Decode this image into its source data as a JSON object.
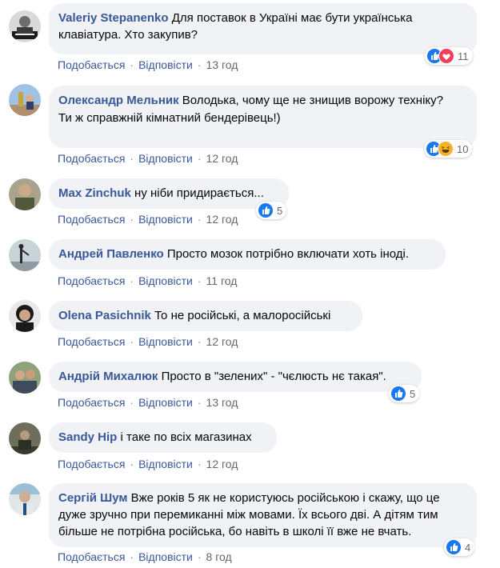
{
  "actions": {
    "like": "Подобається",
    "reply": "Відповісти",
    "sep": "·"
  },
  "colors": {
    "bubble": "#f0f2f5",
    "author": "#385898",
    "meta": "#65676b",
    "like": "#1877f2",
    "love": "#f33e58",
    "haha": "#f7b125"
  },
  "comments": [
    {
      "author": "Valeriy Stepanenko",
      "text": "Для поставок в Україні має бути українська клавіатура. Хто закупив?",
      "time": "13 год",
      "reactions": [
        "like-icon",
        "love-icon"
      ],
      "count": "11"
    },
    {
      "author": "Олександр Мельник",
      "text": "Володька, чому ще не знищив ворожу техніку?\nТи ж справжній кімнатний бендерівець!)",
      "time": "12 год",
      "reactions": [
        "like-icon",
        "haha-icon"
      ],
      "count": "10"
    },
    {
      "author": "Max Zinchuk",
      "text": "ну ніби придирається...",
      "time": "12 год",
      "reactions": [
        "like-icon"
      ],
      "count": "5"
    },
    {
      "author": "Андрей Павленко",
      "text": "Просто мозок потрібно включати хоть іноді.",
      "time": "11 год"
    },
    {
      "author": "Olena Pasichnik",
      "text": "То не російські, а малоросійські",
      "time": "12 год"
    },
    {
      "author": "Андрій Михалюк",
      "text": "Просто в \"зелених\" - \"чєлюсть нє такая\".",
      "time": "13 год",
      "reactions": [
        "like-icon"
      ],
      "count": "5"
    },
    {
      "author": "Sandy Hip",
      "text": "і таке по всіх магазинах",
      "time": "12 год"
    },
    {
      "author": "Сергій Шум",
      "text": "Вже років 5 як не користуюсь російською і скажу, що це дуже зручно при перемиканні між мовами. Їх всього дві. А дітям тим більше не потрібна російська, бо навіть в школі її вже не вчать.",
      "time": "8 год",
      "reactions": [
        "like-icon"
      ],
      "count": "4"
    }
  ]
}
